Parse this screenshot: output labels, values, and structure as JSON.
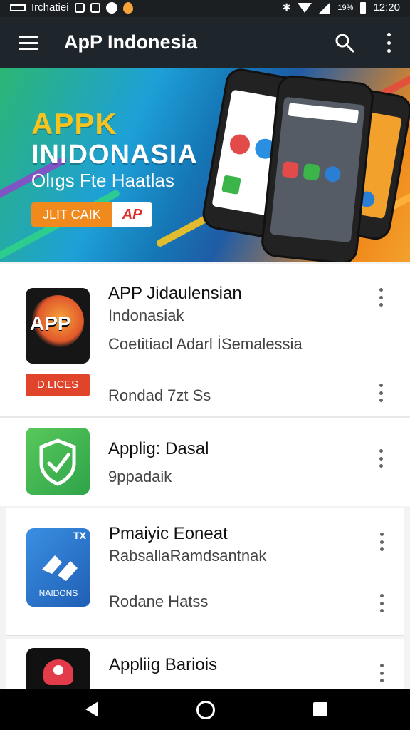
{
  "status_bar": {
    "carrier": "Irchatiei",
    "battery": "19%",
    "time": "12:20"
  },
  "app_bar": {
    "title": "ApP Indonesia"
  },
  "banner": {
    "headline_1": "APPK",
    "headline_2": "INIDONASIA",
    "subheadline": "Olıgs Fte Haatlas",
    "cta_left": "JLIT CAIK",
    "cta_right": "AP"
  },
  "apps": [
    {
      "title": "APP Jidaulensian",
      "subtitle": "Indonasiak",
      "description": "Coetitiacl Adarl İSemalessia",
      "badge": "D.LICES",
      "footer": "Rondad 7zt Ss",
      "icon_text": "APP",
      "icon": "app-fire-logo-icon"
    },
    {
      "title": "Applig: Dasal",
      "subtitle": "9ppadaik",
      "icon": "shield-check-icon"
    },
    {
      "title": "Pmaiyic Eoneat",
      "subtitle": "RabsallaRamdsantnak",
      "footer": "Rodane Hatss",
      "icon_text": "NAIDONS",
      "icon_badge": "TX",
      "icon": "blue-arrows-icon"
    },
    {
      "title": "Appliig Bariois",
      "icon": "red-robot-icon"
    }
  ],
  "colors": {
    "app_bar": "#1f262b",
    "accent_orange": "#f08a1c",
    "accent_red": "#e02b2b",
    "green": "#3bb54a",
    "blue": "#2a7fd4"
  }
}
